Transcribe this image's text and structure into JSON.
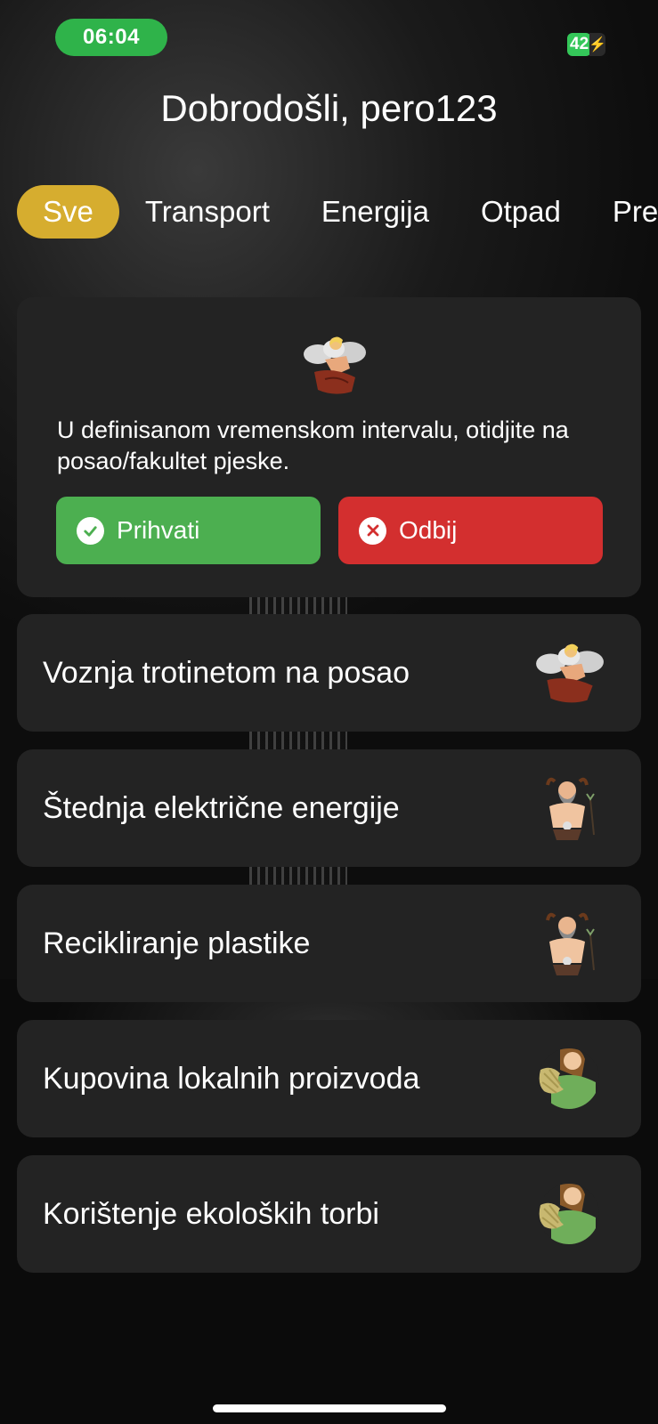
{
  "status_bar": {
    "time": "06:04",
    "battery_level": "42",
    "battery_icon": "charging-bolt-icon"
  },
  "header": {
    "welcome": "Dobrodošli, pero123"
  },
  "tabs": [
    {
      "label": "Sve",
      "active": true
    },
    {
      "label": "Transport",
      "active": false
    },
    {
      "label": "Energija",
      "active": false
    },
    {
      "label": "Otpad",
      "active": false
    },
    {
      "label": "Pre",
      "active": false
    }
  ],
  "challenge": {
    "avatar": "cloud-god-icon",
    "text": "U definisanom vremenskom intervalu, otidjite na posao/fakultet pjeske.",
    "accept_label": "Prihvati",
    "decline_label": "Odbij",
    "accept_color": "#4caf50",
    "decline_color": "#d32f2f"
  },
  "activities": [
    {
      "label": "Voznja trotinetom na posao",
      "avatar": "cloud-god-icon"
    },
    {
      "label": "Štednja električne energije",
      "avatar": "horned-warrior-icon"
    },
    {
      "label": "Recikliranje plastike",
      "avatar": "horned-warrior-icon"
    },
    {
      "label": "Kupovina lokalnih proizvoda",
      "avatar": "earth-goddess-icon"
    },
    {
      "label": "Korištenje ekoloških torbi",
      "avatar": "earth-goddess-icon"
    }
  ],
  "colors": {
    "active_tab": "#d6ad2f",
    "card_bg": "#232323",
    "time_pill": "#2fb34a"
  }
}
